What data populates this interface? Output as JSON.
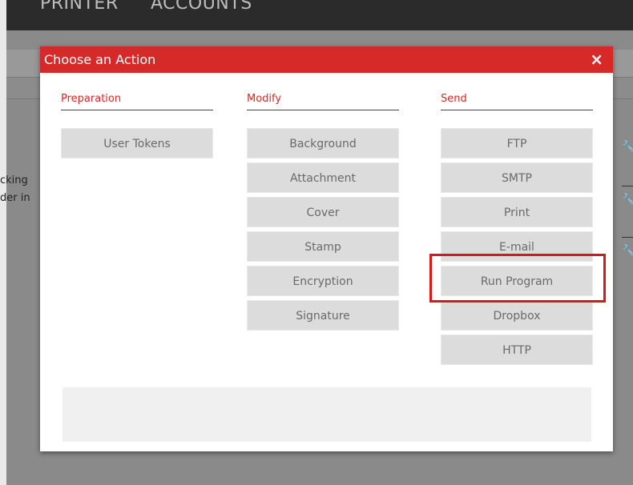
{
  "background": {
    "nav": [
      "PRINTER",
      "ACCOUNTS"
    ],
    "fragments": [
      "cking",
      "der in"
    ],
    "wrench_icon": "wrench-icon"
  },
  "modal": {
    "title": "Choose an Action",
    "close": "×",
    "columns": [
      {
        "title": "Preparation",
        "buttons": [
          "User Tokens"
        ]
      },
      {
        "title": "Modify",
        "buttons": [
          "Background",
          "Attachment",
          "Cover",
          "Stamp",
          "Encryption",
          "Signature"
        ]
      },
      {
        "title": "Send",
        "buttons": [
          "FTP",
          "SMTP",
          "Print",
          "E-mail",
          "Run Program",
          "Dropbox",
          "HTTP"
        ]
      }
    ]
  },
  "colors": {
    "accent": "#d52a27",
    "highlight": "#d61a1a",
    "button_bg": "#dcdcdc",
    "button_text": "#6a6a6a"
  }
}
